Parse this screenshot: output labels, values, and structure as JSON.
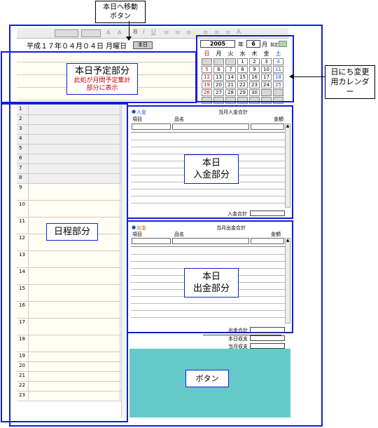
{
  "callouts": {
    "today_button": [
      "本日へ移動",
      "ボタン"
    ],
    "calendar": [
      "日にち変更",
      "用カレンダー"
    ],
    "plan": {
      "title": "本日予定部分",
      "note": [
        "此処が月間予定集計",
        "部分に表示"
      ]
    },
    "schedule": "日程部分",
    "income": [
      "本日",
      "入金部分"
    ],
    "expense": [
      "本日",
      "出金部分"
    ],
    "buttons": "ボタン"
  },
  "header": {
    "date_text": "平成１７年０４月０４日 月曜日",
    "today_button": "本日"
  },
  "toolbar": {
    "font_size_labels": [
      "A",
      "A"
    ],
    "bold": "B",
    "underline": "U",
    "font_color": "A"
  },
  "calendar": {
    "year": "2005",
    "year_unit": "年",
    "month": "6",
    "month_unit": "月",
    "set_date_label": "指定日",
    "weekdays": [
      "日",
      "月",
      "火",
      "水",
      "木",
      "金",
      "土"
    ],
    "weeks": [
      [
        "",
        "",
        "",
        "1",
        "2",
        "3",
        "4"
      ],
      [
        "5",
        "6",
        "7",
        "8",
        "9",
        "10",
        "11"
      ],
      [
        "12",
        "13",
        "14",
        "15",
        "16",
        "17",
        "18"
      ],
      [
        "19",
        "20",
        "21",
        "22",
        "23",
        "24",
        "25"
      ],
      [
        "26",
        "27",
        "28",
        "29",
        "30",
        "",
        ""
      ],
      [
        "",
        "",
        "",
        "",
        "",
        "",
        ""
      ]
    ]
  },
  "schedule_hours": [
    "1",
    "2",
    "3",
    "4",
    "5",
    "6",
    "7",
    "8",
    "9",
    "10",
    "11",
    "12",
    "13",
    "14",
    "15",
    "16",
    "17",
    "18",
    "19",
    "20",
    "21",
    "22",
    "23"
  ],
  "income": {
    "section_label": "入金",
    "month_total_label": "当月入金合計",
    "columns": [
      "項目",
      "品名",
      "金額"
    ],
    "total_label": "入金合計"
  },
  "expense": {
    "section_label": "出金",
    "month_total_label": "当月出金合計",
    "columns": [
      "項目",
      "品名",
      "金額"
    ],
    "total_label": "出金合計"
  },
  "summary": {
    "today_balance_label": "本日収支",
    "month_balance_label": "当月収支"
  },
  "colors": {
    "annotation": "#1020d8",
    "button_area": "#66c9c9",
    "sunday": "#d00000",
    "saturday": "#1a4fd8"
  }
}
